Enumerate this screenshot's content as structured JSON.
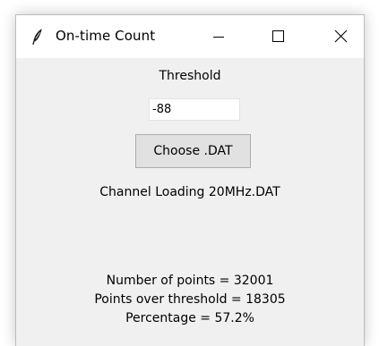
{
  "window": {
    "title": "On-time Count",
    "icon": "feather-icon",
    "controls": [
      "minimize-icon",
      "maximize-icon",
      "close-icon"
    ]
  },
  "threshold": {
    "label": "Threshold",
    "value": "-88"
  },
  "choose_button": {
    "label": "Choose .DAT"
  },
  "file": {
    "name": "Channel Loading 20MHz.DAT"
  },
  "results": {
    "points": "Number of points = 32001",
    "over_threshold": "Points over threshold = 18305",
    "percentage": "Percentage = 57.2%"
  }
}
